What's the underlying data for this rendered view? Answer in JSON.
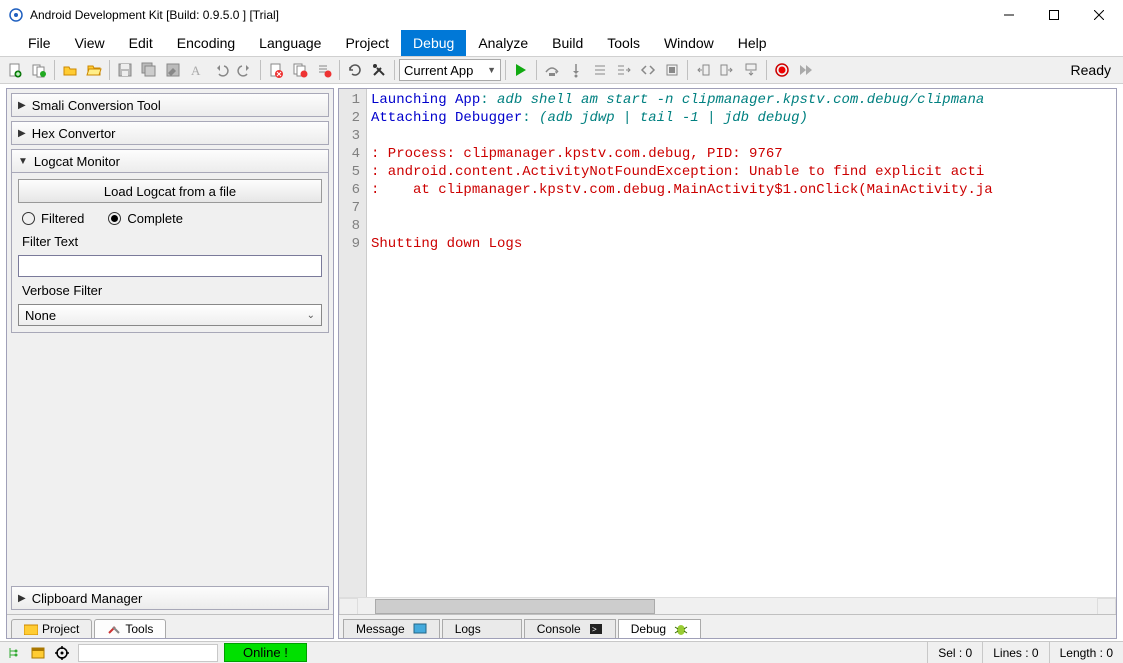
{
  "title": "Android Development Kit [Build: 0.9.5.0 ] [Trial]",
  "menus": [
    "File",
    "View",
    "Edit",
    "Encoding",
    "Language",
    "Project",
    "Debug",
    "Analyze",
    "Build",
    "Tools",
    "Window",
    "Help"
  ],
  "active_menu": "Debug",
  "toolbar": {
    "combo": "Current App",
    "ready": "Ready"
  },
  "sidebar": {
    "smali": "Smali Conversion Tool",
    "hex": "Hex Convertor",
    "logcat": {
      "title": "Logcat Monitor",
      "load_btn": "Load Logcat from a file",
      "filtered": "Filtered",
      "complete": "Complete",
      "filter_text_label": "Filter Text",
      "verbose_label": "Verbose Filter",
      "verbose_value": "None"
    },
    "clipboard": "Clipboard Manager",
    "tabs": {
      "project": "Project",
      "tools": "Tools"
    }
  },
  "editor": {
    "lines": [
      {
        "n": 1,
        "segments": [
          {
            "t": "Launching App",
            "c": "kw"
          },
          {
            "t": ": ",
            "c": "sep"
          },
          {
            "t": "adb shell am start -n clipmanager.kpstv.com.debug/clipmana",
            "c": "cmd"
          }
        ]
      },
      {
        "n": 2,
        "segments": [
          {
            "t": "Attaching Debugger",
            "c": "kw"
          },
          {
            "t": ": ",
            "c": "sep"
          },
          {
            "t": "(adb jdwp | tail -1 | jdb debug)",
            "c": "cmd"
          }
        ]
      },
      {
        "n": 3,
        "segments": []
      },
      {
        "n": 4,
        "segments": [
          {
            "t": ": Process: clipmanager.kpstv.com.debug, PID: 9767",
            "c": "err"
          }
        ]
      },
      {
        "n": 5,
        "segments": [
          {
            "t": ": android.content.ActivityNotFoundException: Unable to find explicit acti",
            "c": "err"
          }
        ]
      },
      {
        "n": 6,
        "segments": [
          {
            "t": ":    at clipmanager.kpstv.com.debug.MainActivity$1.onClick(MainActivity.ja",
            "c": "err"
          }
        ]
      },
      {
        "n": 7,
        "segments": []
      },
      {
        "n": 8,
        "segments": []
      },
      {
        "n": 9,
        "segments": [
          {
            "t": "Shutting down Logs",
            "c": "err"
          }
        ]
      }
    ],
    "tabs": [
      "Message",
      "Logs",
      "Console",
      "Debug"
    ],
    "active_tab": "Debug"
  },
  "status": {
    "online": "Online !",
    "sel": "Sel :  0",
    "lines": "Lines :  0",
    "length": "Length :  0"
  }
}
